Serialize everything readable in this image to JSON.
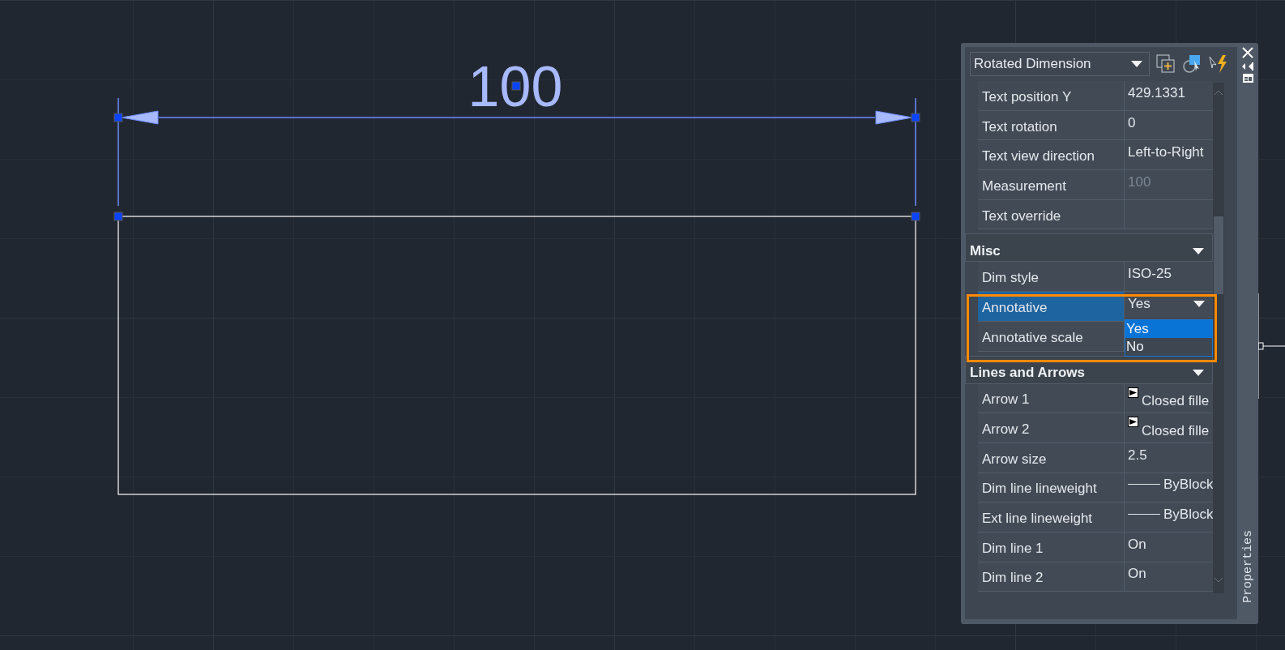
{
  "drawing": {
    "dimension_text": "100"
  },
  "properties_panel": {
    "object_type": "Rotated Dimension",
    "side_title": "Properties",
    "rows": [
      {
        "kind": "text",
        "label": "Text position Y",
        "value": "429.1331",
        "selected": false
      },
      {
        "kind": "text",
        "label": "Text rotation",
        "value": "0",
        "selected": false
      },
      {
        "kind": "text",
        "label": "Text view direction",
        "value": "Left-to-Right",
        "selected": false
      },
      {
        "kind": "readonly",
        "label": "Measurement",
        "value": "100",
        "selected": false
      },
      {
        "kind": "text",
        "label": "Text override",
        "selected": false
      },
      {
        "kind": "section",
        "label": "Misc",
        "expanded": true,
        "selected": false
      },
      {
        "kind": "text",
        "label": "Dim style",
        "value": "ISO-25",
        "selected": false
      },
      {
        "kind": "dropdown",
        "label": "Annotative",
        "value": "Yes",
        "selected": true,
        "highlighted": true,
        "open": true,
        "options": [
          {
            "label": "Yes",
            "selected": true
          },
          {
            "label": "No",
            "selected": false
          }
        ]
      },
      {
        "kind": "text",
        "label": "Annotative scale",
        "selected": false
      },
      {
        "kind": "section",
        "label": "Lines and Arrows",
        "expanded": true,
        "selected": false
      },
      {
        "kind": "arrowhead",
        "label": "Arrow 1",
        "value": "Closed fille",
        "selected": false
      },
      {
        "kind": "arrowhead",
        "label": "Arrow 2",
        "value": "Closed fille",
        "selected": false
      },
      {
        "kind": "text",
        "label": "Arrow size",
        "value": "2.5",
        "selected": false
      },
      {
        "kind": "lineweight",
        "label": "Dim line lineweight",
        "value": "ByBlock",
        "selected": false
      },
      {
        "kind": "lineweight",
        "label": "Ext line lineweight",
        "value": "ByBlock",
        "selected": false
      },
      {
        "kind": "text",
        "label": "Dim line 1",
        "value": "On",
        "selected": false
      },
      {
        "kind": "text",
        "label": "Dim line 2",
        "value": "On",
        "selected": false
      }
    ]
  }
}
